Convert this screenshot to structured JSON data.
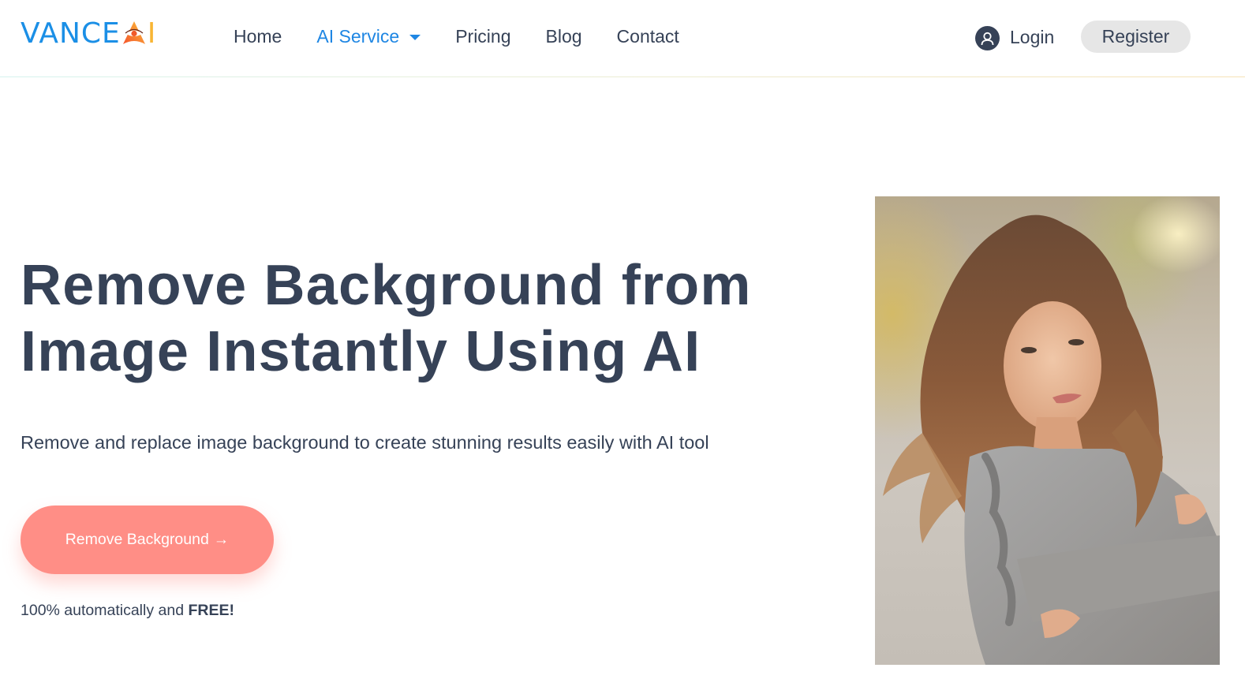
{
  "header": {
    "logo": {
      "text": "VANCE",
      "suffix": "I",
      "icon": "eye-triangle-icon",
      "brand_color": "#1b8fe6",
      "accent_color": "#f8a532"
    },
    "nav": [
      {
        "label": "Home",
        "active": false
      },
      {
        "label": "AI Service",
        "active": true,
        "has_dropdown": true
      },
      {
        "label": "Pricing",
        "active": false
      },
      {
        "label": "Blog",
        "active": false
      },
      {
        "label": "Contact",
        "active": false
      }
    ],
    "login_label": "Login",
    "register_label": "Register"
  },
  "hero": {
    "title_line1": "Remove Background from",
    "title_line2": "Image Instantly Using AI",
    "subtitle": "Remove and replace image background to create stunning results easily with AI tool",
    "cta_label": "Remove Background",
    "cta_arrow": "→",
    "note_prefix": "100% automatically and ",
    "note_bold": "FREE!",
    "image_alt": "Girl with long wavy hair in grey ruffled top, arms crossed, blurred outdoor background"
  },
  "colors": {
    "text": "#364257",
    "nav_active": "#1e86e3",
    "cta": "#ff8e86",
    "register_bg": "#e6e6e6"
  }
}
